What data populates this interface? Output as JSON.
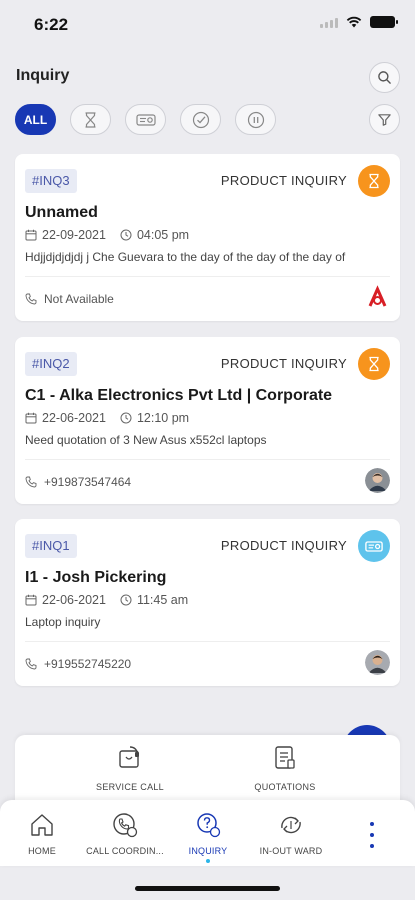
{
  "status_bar": {
    "time": "6:22"
  },
  "header": {
    "title": "Inquiry"
  },
  "filters": {
    "all_label": "ALL"
  },
  "inquiries": [
    {
      "id": "#INQ3",
      "type": "PRODUCT INQUIRY",
      "status_icon": "hourglass-icon",
      "status_color": "#f7941d",
      "name": "Unnamed",
      "date": "22-09-2021",
      "time": "04:05 pm",
      "description": "Hdjjdjdjdjdj j Che Guevara to the day of the day of the day of",
      "phone": "Not Available",
      "avatar": "red-logo-avatar"
    },
    {
      "id": "#INQ2",
      "type": "PRODUCT INQUIRY",
      "status_icon": "hourglass-icon",
      "status_color": "#f7941d",
      "name": "C1 - Alka Electronics Pvt Ltd | Corporate",
      "date": "22-06-2021",
      "time": "12:10 pm",
      "description": "Need quotation of 3 New Asus x552cl laptops",
      "phone": "+919873547464",
      "avatar": "person-photo-avatar"
    },
    {
      "id": "#INQ1",
      "type": "PRODUCT INQUIRY",
      "status_icon": "ticket-icon",
      "status_color": "#5ec3ec",
      "name": "I1 - Josh Pickering",
      "date": "22-06-2021",
      "time": "11:45 am",
      "description": "Laptop inquiry",
      "phone": "+919552745220",
      "avatar": "person-photo-avatar"
    }
  ],
  "quick_actions": [
    {
      "label": "SERVICE CALL",
      "icon": "service-call-icon"
    },
    {
      "label": "QUOTATIONS",
      "icon": "quotation-doc-icon"
    }
  ],
  "bottom_nav": [
    {
      "label": "HOME",
      "icon": "home-icon",
      "active": false
    },
    {
      "label": "CALL COORDIN...",
      "icon": "call-coordinate-icon",
      "active": false
    },
    {
      "label": "INQUIRY",
      "icon": "inquiry-icon",
      "active": true
    },
    {
      "label": "IN-OUT WARD",
      "icon": "inout-ward-icon",
      "active": false
    }
  ],
  "colors": {
    "primary": "#1838b4",
    "pending": "#f7941d",
    "open": "#5ec3ec",
    "background": "#ececf0"
  }
}
